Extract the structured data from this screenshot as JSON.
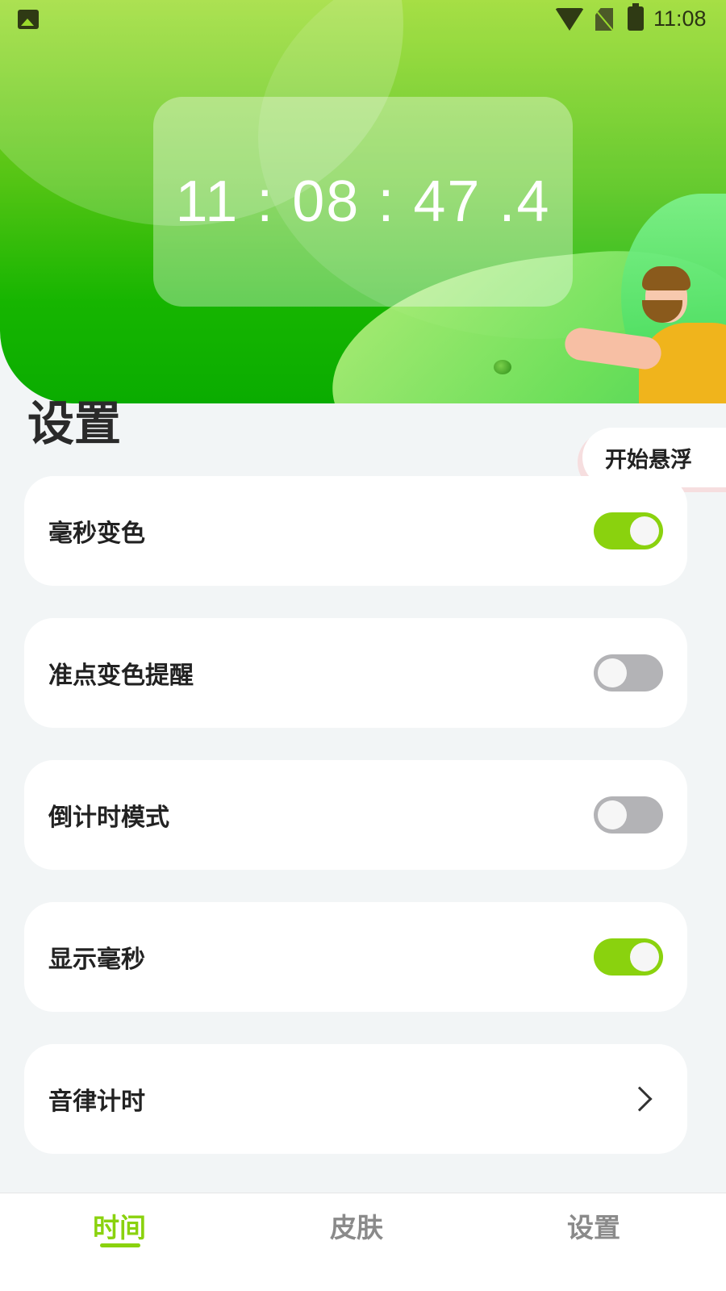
{
  "status_bar": {
    "time": "11:08",
    "icons": [
      "image-notification-icon",
      "wifi-icon",
      "no-sim-icon",
      "battery-charging-icon"
    ]
  },
  "header": {
    "clock": "11 : 08 : 47 .4"
  },
  "section": {
    "title": "设置"
  },
  "float_button": {
    "label": "开始悬浮"
  },
  "settings": [
    {
      "label": "毫秒变色",
      "type": "toggle",
      "on": true
    },
    {
      "label": "准点变色提醒",
      "type": "toggle",
      "on": false
    },
    {
      "label": "倒计时模式",
      "type": "toggle",
      "on": false
    },
    {
      "label": "显示毫秒",
      "type": "toggle",
      "on": true
    },
    {
      "label": "音律计时",
      "type": "link",
      "icon": "chevron-right-icon"
    }
  ],
  "bottom_nav": {
    "items": [
      {
        "label": "时间",
        "active": true
      },
      {
        "label": "皮肤",
        "active": false
      },
      {
        "label": "设置",
        "active": false
      }
    ]
  },
  "colors": {
    "accent": "#8ad20e",
    "toggle_off": "#b3b3b6",
    "background": "#f2f5f6"
  }
}
